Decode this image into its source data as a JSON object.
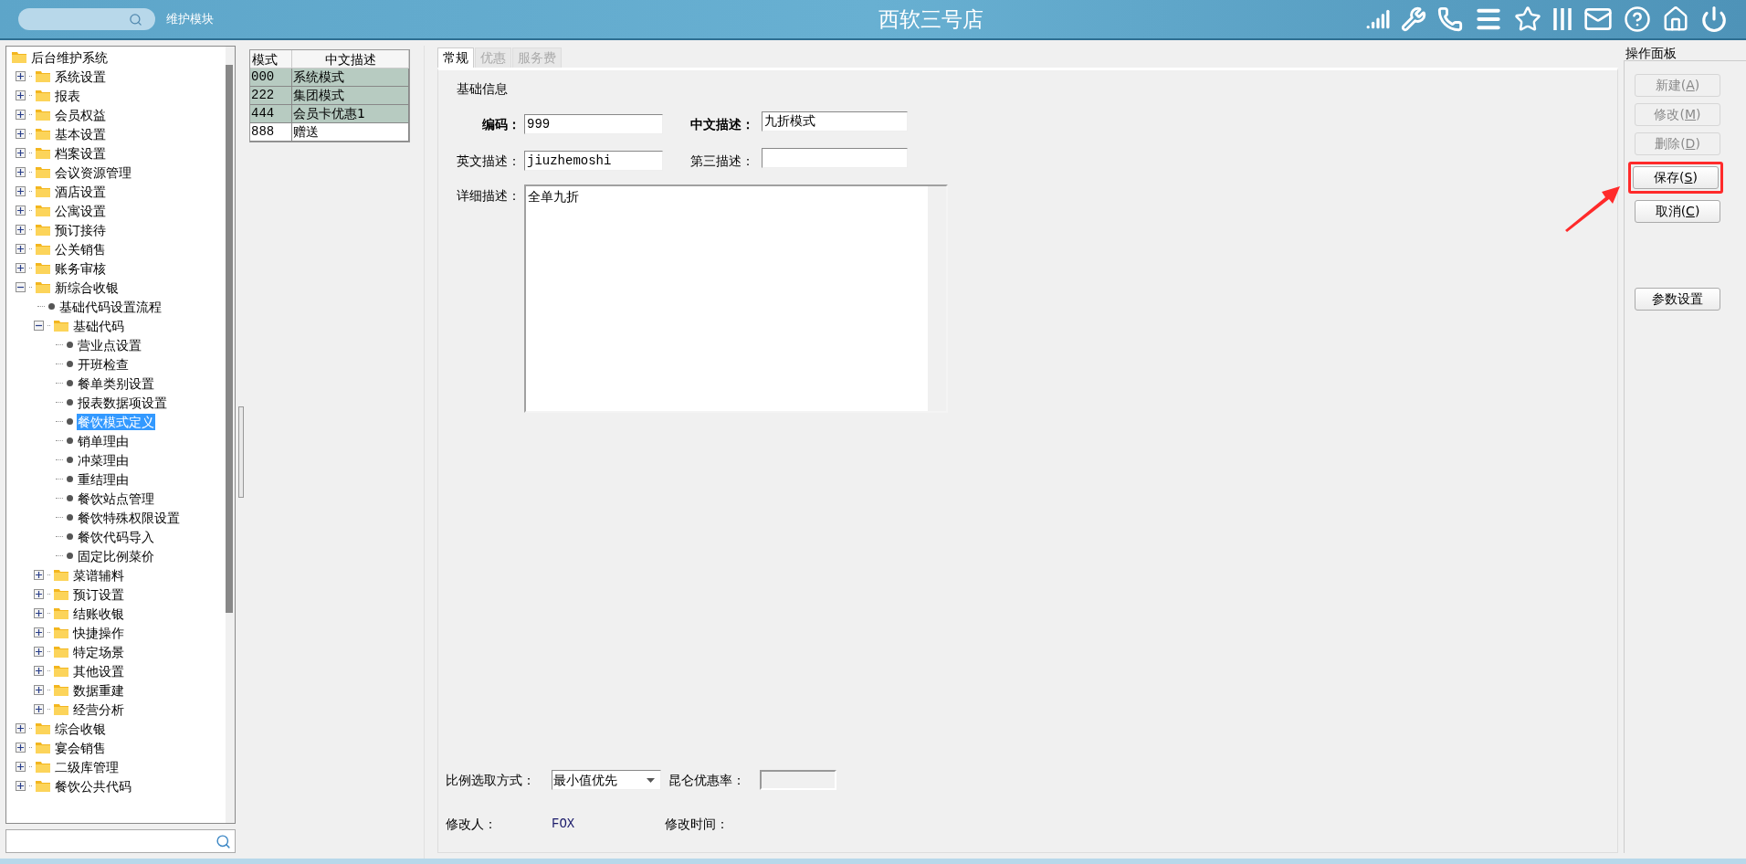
{
  "header": {
    "module_label": "维护模块",
    "title": "西软三号店"
  },
  "tree": {
    "items": [
      {
        "label": "后台维护系统",
        "kind": "folder",
        "children": [
          {
            "label": "系统设置",
            "kind": "folder",
            "expanded": false
          },
          {
            "label": "报表",
            "kind": "folder",
            "expanded": false
          },
          {
            "label": "会员权益",
            "kind": "folder",
            "expanded": false
          },
          {
            "label": "基本设置",
            "kind": "folder",
            "expanded": false
          },
          {
            "label": "档案设置",
            "kind": "folder",
            "expanded": false
          },
          {
            "label": "会议资源管理",
            "kind": "folder",
            "expanded": false
          },
          {
            "label": "酒店设置",
            "kind": "folder",
            "expanded": false
          },
          {
            "label": "公寓设置",
            "kind": "folder",
            "expanded": false
          },
          {
            "label": "预订接待",
            "kind": "folder",
            "expanded": false
          },
          {
            "label": "公关销售",
            "kind": "folder",
            "expanded": false
          },
          {
            "label": "账务审核",
            "kind": "folder",
            "expanded": false
          },
          {
            "label": "新综合收银",
            "kind": "folder",
            "expanded": true,
            "children": [
              {
                "label": "基础代码设置流程",
                "kind": "leaf",
                "selected": false
              },
              {
                "label": "基础代码",
                "kind": "folder",
                "expanded": true,
                "children": [
                  {
                    "label": "营业点设置",
                    "kind": "leaf",
                    "selected": false
                  },
                  {
                    "label": "开班检查",
                    "kind": "leaf",
                    "selected": false
                  },
                  {
                    "label": "餐单类别设置",
                    "kind": "leaf",
                    "selected": false
                  },
                  {
                    "label": "报表数据项设置",
                    "kind": "leaf",
                    "selected": false
                  },
                  {
                    "label": "餐饮模式定义",
                    "kind": "leaf",
                    "selected": true
                  },
                  {
                    "label": "销单理由",
                    "kind": "leaf",
                    "selected": false
                  },
                  {
                    "label": "冲菜理由",
                    "kind": "leaf",
                    "selected": false
                  },
                  {
                    "label": "重结理由",
                    "kind": "leaf",
                    "selected": false
                  },
                  {
                    "label": "餐饮站点管理",
                    "kind": "leaf",
                    "selected": false
                  },
                  {
                    "label": "餐饮特殊权限设置",
                    "kind": "leaf",
                    "selected": false
                  },
                  {
                    "label": "餐饮代码导入",
                    "kind": "leaf",
                    "selected": false
                  },
                  {
                    "label": "固定比例菜价",
                    "kind": "leaf",
                    "selected": false
                  }
                ]
              },
              {
                "label": "菜谱辅料",
                "kind": "folder",
                "expanded": false
              },
              {
                "label": "预订设置",
                "kind": "folder",
                "expanded": false
              },
              {
                "label": "结账收银",
                "kind": "folder",
                "expanded": false
              },
              {
                "label": "快捷操作",
                "kind": "folder",
                "expanded": false
              },
              {
                "label": "特定场景",
                "kind": "folder",
                "expanded": false
              },
              {
                "label": "其他设置",
                "kind": "folder",
                "expanded": false
              },
              {
                "label": "数据重建",
                "kind": "folder",
                "expanded": false
              },
              {
                "label": "经营分析",
                "kind": "folder",
                "expanded": false
              }
            ]
          },
          {
            "label": "综合收银",
            "kind": "folder",
            "expanded": false
          },
          {
            "label": "宴会销售",
            "kind": "folder",
            "expanded": false
          },
          {
            "label": "二级库管理",
            "kind": "folder",
            "expanded": false
          },
          {
            "label": "餐饮公共代码",
            "kind": "folder",
            "expanded": false
          }
        ]
      }
    ]
  },
  "table": {
    "columns": [
      "模式",
      "中文描述"
    ],
    "rows": [
      {
        "cells": [
          "000",
          "系统模式"
        ],
        "selected": true
      },
      {
        "cells": [
          "222",
          "集团模式"
        ],
        "selected": true
      },
      {
        "cells": [
          "444",
          "会员卡优惠1"
        ],
        "selected": true
      },
      {
        "cells": [
          "888",
          "赠送"
        ],
        "selected": false
      }
    ]
  },
  "tabs": [
    {
      "label": "常规",
      "selected": true,
      "disabled": false
    },
    {
      "label": "优惠",
      "selected": false,
      "disabled": true
    },
    {
      "label": "服务费",
      "selected": false,
      "disabled": true
    }
  ],
  "form": {
    "section": "基础信息",
    "code": {
      "label": "编码：",
      "value": "999",
      "bold": true
    },
    "cn_desc": {
      "label": "中文描述：",
      "value": "九折模式",
      "bold": true
    },
    "en_desc": {
      "label": "英文描述：",
      "value": "jiuzhemoshi",
      "bold": false
    },
    "third_desc": {
      "label": "第三描述：",
      "bold": false
    },
    "detail": {
      "label": "详细描述：",
      "value": "全单九折"
    },
    "ratio_mode": {
      "label": "比例选取方式：",
      "value": "最小值优先"
    },
    "kunlun_rate": {
      "label": "昆仑优惠率：",
      "disabled": true
    },
    "modifier": {
      "label": "修改人：",
      "value": "FOX"
    },
    "modified_time": {
      "label": "修改时间："
    }
  },
  "panel": {
    "title": "操作面板",
    "buttons": [
      {
        "label": "新建(A)",
        "disabled": true,
        "highlighted": false
      },
      {
        "label": "修改(M)",
        "disabled": true,
        "highlighted": false
      },
      {
        "label": "删除(D)",
        "disabled": true,
        "highlighted": false
      },
      {
        "label": "保存(S)",
        "disabled": false,
        "highlighted": true
      },
      {
        "label": "取消(C)",
        "disabled": false,
        "highlighted": false
      }
    ],
    "settings_button": "参数设置"
  }
}
